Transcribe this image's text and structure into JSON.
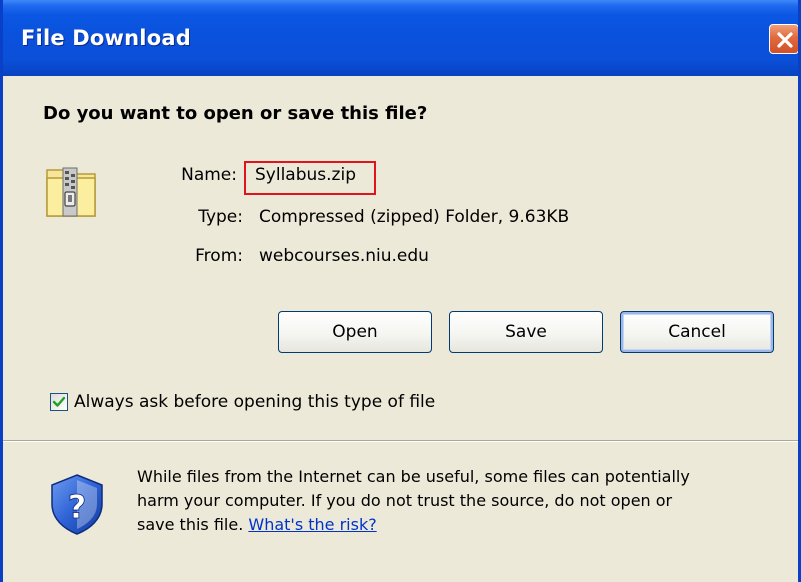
{
  "window": {
    "title": "File Download",
    "close_icon": "close-icon"
  },
  "dialog": {
    "heading": "Do you want to open or save this file?",
    "file_icon": "zip-folder-icon",
    "fields": {
      "name_label": "Name:",
      "name_value": "Syllabus.zip",
      "type_label": "Type:",
      "type_value": "Compressed (zipped) Folder, 9.63KB",
      "from_label": "From:",
      "from_value": "webcourses.niu.edu"
    },
    "buttons": {
      "open_label": "Open",
      "save_label": "Save",
      "cancel_label": "Cancel"
    },
    "checkbox": {
      "checked": true,
      "label": "Always ask before opening this type of file"
    },
    "warning": {
      "icon": "shield-question-icon",
      "line1": "While files from the Internet can be useful, some files can potentially",
      "line2": "harm your computer. If you do not trust the source, do not open or",
      "line3_prefix": "save this file.",
      "link_text": "What's the risk?"
    }
  },
  "colors": {
    "titlebar": "#0a51dc",
    "dialog_bg": "#ece9d8",
    "highlight_box": "#e0141c",
    "link": "#0033cc",
    "close_button": "#d2502a"
  }
}
